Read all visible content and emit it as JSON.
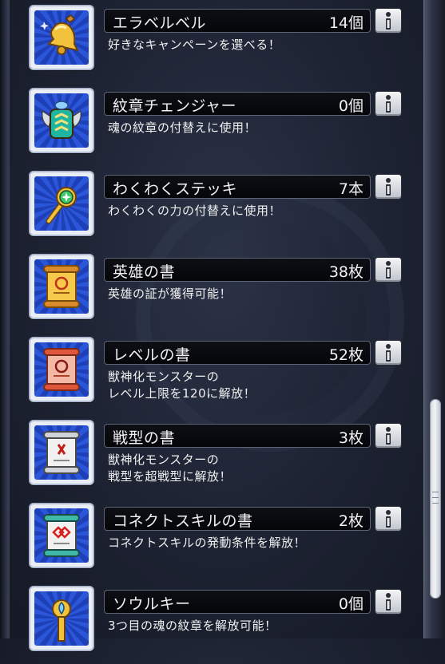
{
  "items": [
    {
      "name": "エラベルベル",
      "count": "14個",
      "desc": "好きなキャンペーンを選べる！",
      "icon": "bell-icon"
    },
    {
      "name": "紋章チェンジャー",
      "count": "0個",
      "desc": "魂の紋章の付替えに使用！",
      "icon": "emblem-changer-icon"
    },
    {
      "name": "わくわくステッキ",
      "count": "7本",
      "desc": "わくわくの力の付替えに使用！",
      "icon": "wand-icon"
    },
    {
      "name": "英雄の書",
      "count": "38枚",
      "desc": "英雄の証が獲得可能！",
      "icon": "scroll-hero-icon"
    },
    {
      "name": "レベルの書",
      "count": "52枚",
      "desc": "獣神化モンスターの\nレベル上限を120に解放！",
      "icon": "scroll-level-icon"
    },
    {
      "name": "戦型の書",
      "count": "3枚",
      "desc": "獣神化モンスターの\n戦型を超戦型に解放！",
      "icon": "scroll-battle-type-icon"
    },
    {
      "name": "コネクトスキルの書",
      "count": "2枚",
      "desc": "コネクトスキルの発動条件を解放！",
      "icon": "scroll-connect-skill-icon"
    },
    {
      "name": "ソウルキー",
      "count": "0個",
      "desc": "3つ目の魂の紋章を解放可能！",
      "icon": "soul-key-icon"
    }
  ],
  "colors": {
    "icon_bg": "#2c56d8",
    "bar_bg": "#07080c",
    "text": "#f2f2f2"
  }
}
